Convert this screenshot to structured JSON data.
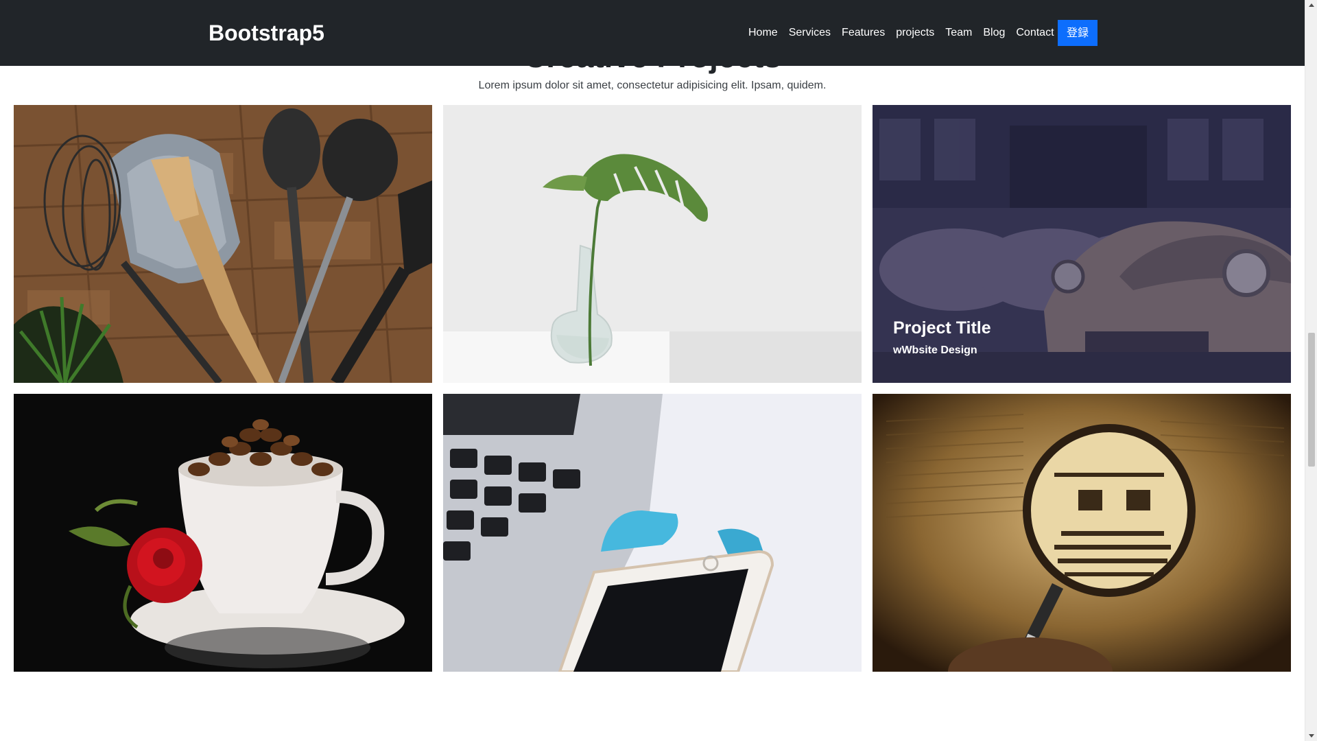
{
  "navbar": {
    "brand": "Bootstrap5",
    "links": [
      "Home",
      "Services",
      "Features",
      "projects",
      "Team",
      "Blog",
      "Contact"
    ],
    "login_button": "登録",
    "accent_color": "#0d6efd",
    "background_color": "#212529"
  },
  "section": {
    "title": "Creative Projects",
    "subtitle": "Lorem ipsum dolor sit amet, consectetur adipisicing elit. Ipsam, quidem."
  },
  "gallery": {
    "items": [
      {
        "image": "kitchen-utensils-photo"
      },
      {
        "image": "plant-in-vase-photo"
      },
      {
        "image": "vintage-cars-photo",
        "title": "Project Title",
        "subtitle": "wWbsite Design"
      },
      {
        "image": "coffee-cup-rose-photo"
      },
      {
        "image": "laptop-phone-photo"
      },
      {
        "image": "magnifying-glass-book-photo"
      }
    ]
  }
}
